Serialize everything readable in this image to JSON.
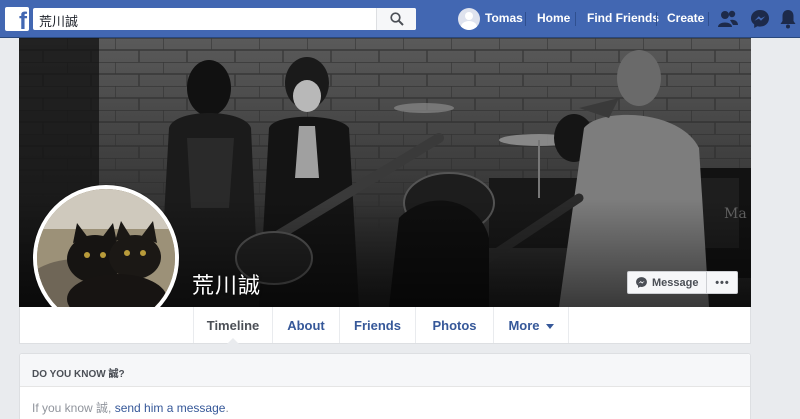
{
  "topbar": {
    "logo": "f",
    "search_value": "荒川誠",
    "user_name": "Tomas",
    "home_label": "Home",
    "find_friends_label": "Find Friends",
    "create_label": "Create",
    "icons": [
      "search-icon",
      "friend-requests-icon",
      "messenger-icon",
      "notifications-icon"
    ],
    "colors": {
      "brand": "#4267b2",
      "link": "#365899"
    }
  },
  "profile": {
    "name": "荒川誠",
    "message_button": "Message",
    "more_button": "•••"
  },
  "tabs": [
    {
      "label": "Timeline",
      "active": true
    },
    {
      "label": "About"
    },
    {
      "label": "Friends"
    },
    {
      "label": "Photos"
    },
    {
      "label": "More"
    }
  ],
  "know_card": {
    "heading": "DO YOU KNOW 誠?",
    "text_prefix": "If you know 誠, ",
    "link_text": "send him a message",
    "text_suffix": "."
  }
}
